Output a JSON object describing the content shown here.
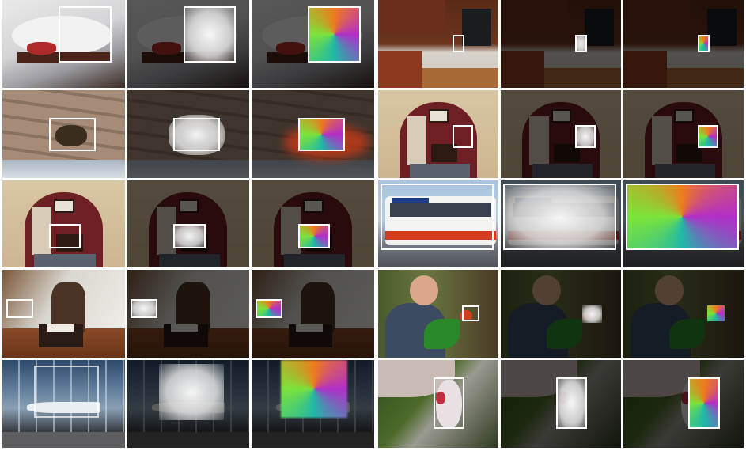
{
  "figure": {
    "left_panel": [
      {
        "scene": "cat-on-table",
        "icon": "cat-photo"
      },
      {
        "scene": "cat-on-stairs",
        "icon": "cat-photo"
      },
      {
        "scene": "dining-room-archway",
        "icon": "room-photo"
      },
      {
        "scene": "chair-living-room",
        "icon": "room-photo"
      },
      {
        "scene": "yacht-building-reflection",
        "icon": "street-photo"
      }
    ],
    "right_panel": [
      {
        "scene": "kitchen",
        "icon": "room-photo"
      },
      {
        "scene": "dining-room-archway",
        "icon": "room-photo"
      },
      {
        "scene": "articulated-bus",
        "icon": "bus-photo"
      },
      {
        "scene": "man-with-parrot",
        "icon": "person-photo"
      },
      {
        "scene": "bird-closeup",
        "icon": "bird-photo"
      }
    ],
    "columns": [
      "input-with-box",
      "mask",
      "color-coded-parts"
    ],
    "colors": {
      "box_outline": "#ffffff",
      "part_top_left": "#7be33a",
      "part_top_right": "#1fb8a8",
      "part_bottom_left": "#f07a1c",
      "part_bottom_right": "#b22fc8"
    }
  }
}
